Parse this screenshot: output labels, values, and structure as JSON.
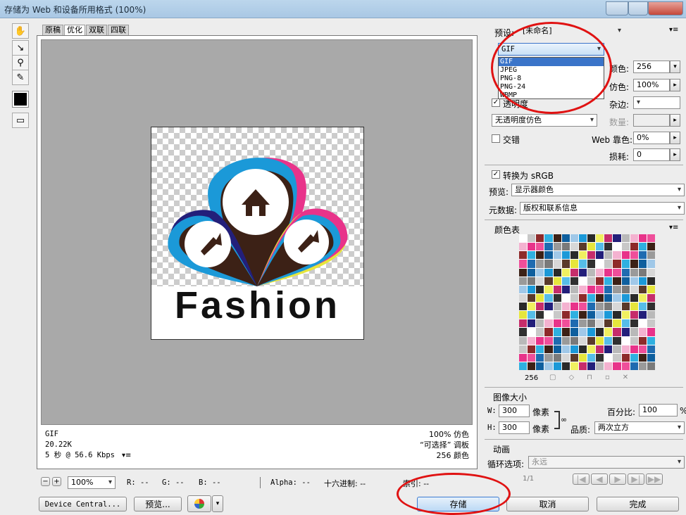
{
  "window": {
    "title": "存储为 Web 和设备所用格式 (100%)"
  },
  "tabs": [
    "原稿",
    "优化",
    "双联",
    "四联"
  ],
  "image": {
    "logo_text": "Fashion"
  },
  "preview_info": {
    "left": [
      "GIF",
      "20.22K",
      "5 秒 @ 56.6 Kbps"
    ],
    "right": [
      "100% 仿色",
      "“可选择” 调板",
      "256 颜色"
    ]
  },
  "statusbar": {
    "zoom": "100%",
    "r": "R: --",
    "g": "G: --",
    "b": "B: --",
    "alpha": "Alpha: --",
    "hex": "十六进制: --",
    "index": "索引: --"
  },
  "bottom_buttons": {
    "device_central": "Device Central...",
    "preview": "预览...",
    "save": "存储",
    "cancel": "取消",
    "done": "完成"
  },
  "settings": {
    "preset_label": "预设:",
    "preset_value": "[未命名]",
    "format_value": "GIF",
    "format_options": [
      "GIF",
      "JPEG",
      "PNG-8",
      "PNG-24",
      "WBMP"
    ],
    "colors_label": "颜色:",
    "colors_value": "256",
    "dither_label": "仿色:",
    "dither_value": "100%",
    "transparency_label": "透明度",
    "matte_label": "杂边:",
    "trans_dither_value": "无透明度仿色",
    "amount_label": "数量:",
    "interlaced_label": "交错",
    "web_snap_label": "Web 靠色:",
    "web_snap_value": "0%",
    "lossy_label": "损耗:",
    "lossy_value": "0",
    "convert_srgb_label": "转换为 sRGB",
    "preview_label": "预览:",
    "preview_value": "显示器颜色",
    "metadata_label": "元数据:",
    "metadata_value": "版权和联系信息"
  },
  "color_table": {
    "title": "颜色表",
    "count": "256",
    "palette": [
      "#ffffff",
      "#1b99d8",
      "#e8338a",
      "#e6e63c",
      "#3c2116",
      "#231f7a",
      "#7a7a7a",
      "#c8c8c8",
      "#2a2a2a",
      "#ef4f9a",
      "#56bde8",
      "#0e5f9e",
      "#b9b9b9",
      "#d8d8d8",
      "#8e2a2a",
      "#f0f060",
      "#1f6bb0",
      "#303030",
      "#a0c8e8",
      "#f4b2d0",
      "#5a3a2a",
      "#2fb0e0",
      "#c62d6b",
      "#9a9a9a"
    ]
  },
  "image_size": {
    "title": "图像大小",
    "w_label": "W:",
    "w_value": "300",
    "w_unit": "像素",
    "h_label": "H:",
    "h_value": "300",
    "h_unit": "像素",
    "percent_label": "百分比:",
    "percent_value": "100",
    "quality_label": "品质:",
    "quality_value": "两次立方"
  },
  "animation": {
    "title": "动画",
    "loop_label": "循环选项:",
    "loop_value": "永远",
    "frame_counter": "1/1"
  }
}
